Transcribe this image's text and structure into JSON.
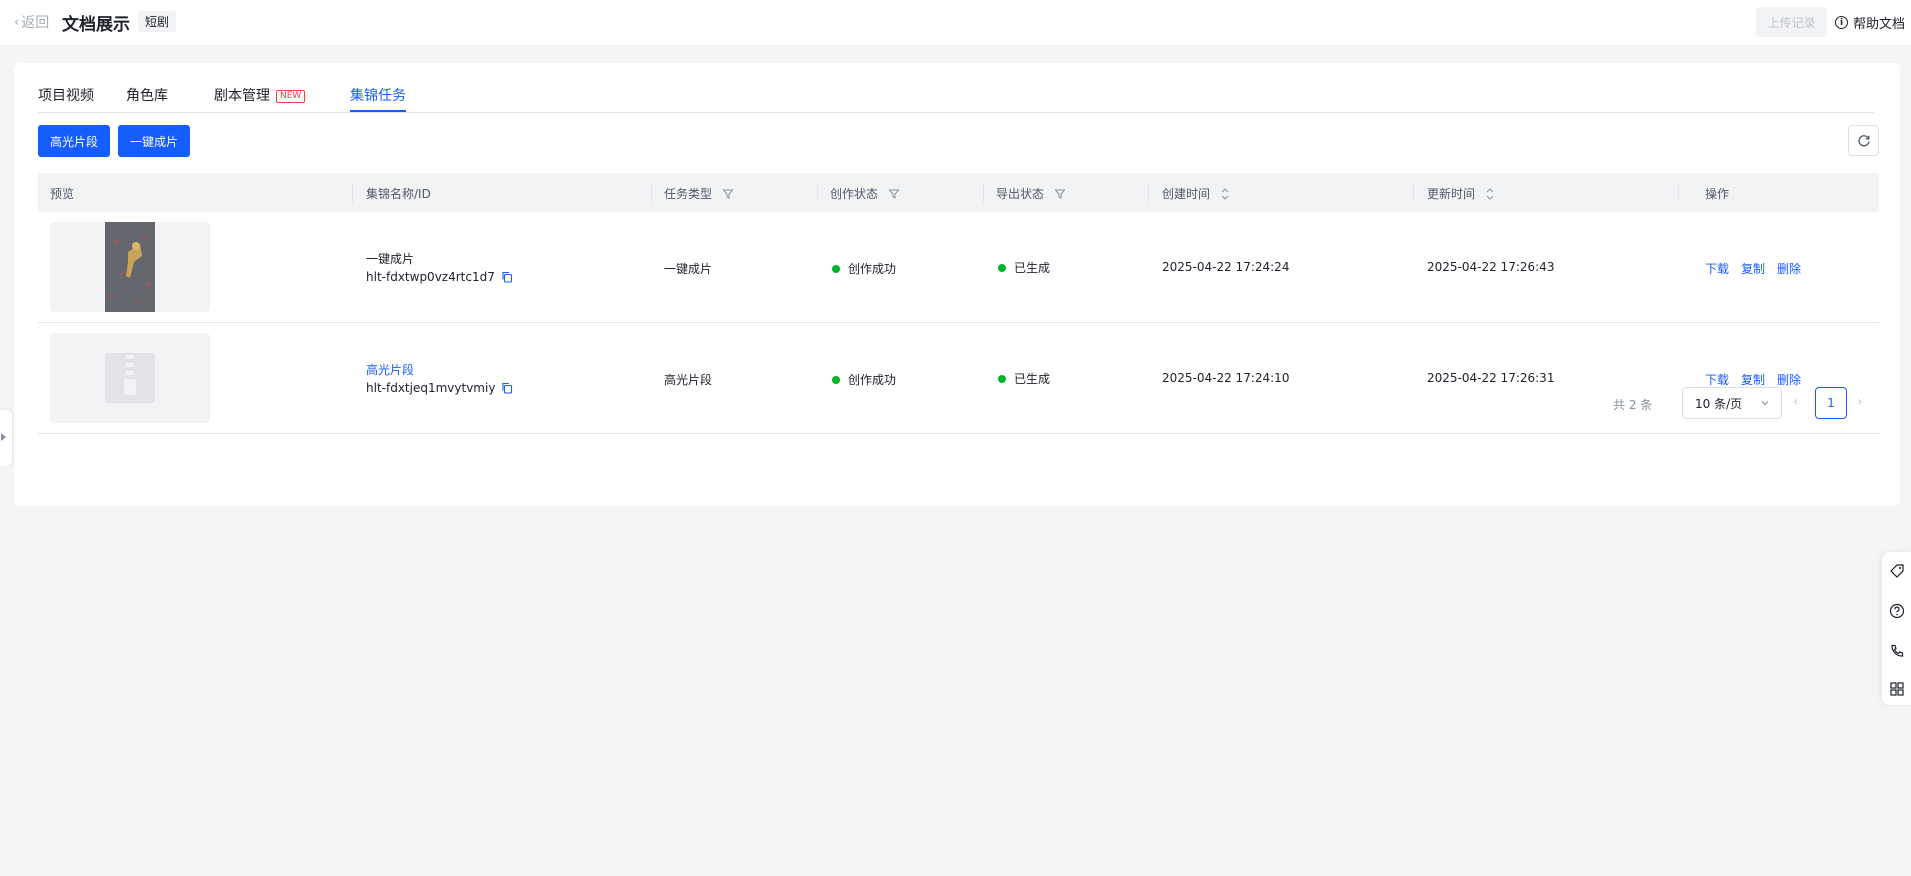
{
  "header": {
    "back_label": "返回",
    "title": "文档展示",
    "tag": "短剧",
    "upload_label": "上传记录",
    "help_label": "帮助文档"
  },
  "tabs": [
    {
      "label": "项目视频",
      "active": false
    },
    {
      "label": "角色库",
      "active": false
    },
    {
      "label": "剧本管理",
      "badge": "NEW",
      "active": false
    },
    {
      "label": "集锦任务",
      "active": true
    }
  ],
  "toolbar": {
    "highlight_btn": "高光片段",
    "oneclick_btn": "一键成片"
  },
  "table": {
    "columns": [
      "预览",
      "集锦名称/ID",
      "任务类型",
      "创作状态",
      "导出状态",
      "创建时间",
      "更新时间",
      "操作"
    ],
    "rows": [
      {
        "name": "一键成片",
        "id": "hlt-fdxtwp0vz4rtc1d7",
        "task_type": "一键成片",
        "create_status": "创作成功",
        "export_status": "已生成",
        "created_at": "2025-04-22 17:24:24",
        "updated_at": "2025-04-22 17:26:43",
        "actions": [
          "下载",
          "复制",
          "删除"
        ]
      },
      {
        "name": "高光片段",
        "id": "hlt-fdxtjeq1mvytvmiy",
        "task_type": "高光片段",
        "create_status": "创作成功",
        "export_status": "已生成",
        "created_at": "2025-04-22 17:24:10",
        "updated_at": "2025-04-22 17:26:31",
        "actions": [
          "下载",
          "复制",
          "删除"
        ]
      }
    ]
  },
  "pagination": {
    "total": "共 2 条",
    "page_size": "10 条/页",
    "current_page": "1"
  },
  "colors": {
    "accent": "#165dff",
    "success": "#00b42a",
    "badge_red": "#f53f3f"
  }
}
